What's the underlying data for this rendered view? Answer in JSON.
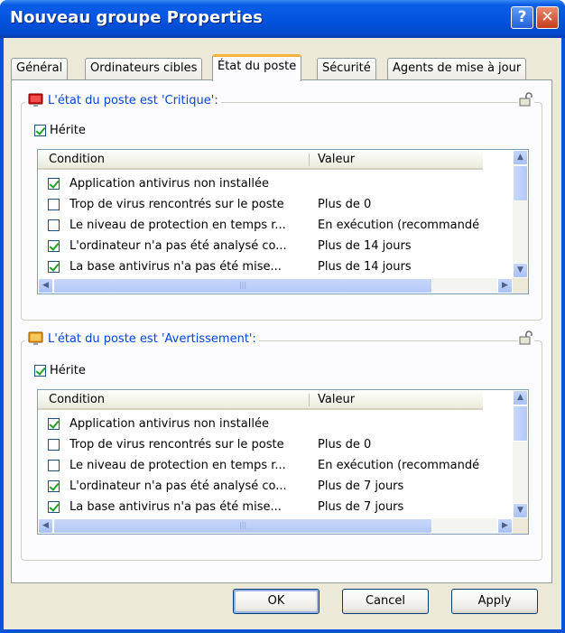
{
  "window": {
    "title": "Nouveau groupe Properties",
    "help_glyph": "?",
    "close_glyph": "✕"
  },
  "tabs": [
    "Général",
    "Ordinateurs cibles",
    "État du poste",
    "Sécurité",
    "Agents de mise à jour"
  ],
  "active_tab": 2,
  "groups": [
    {
      "title": "L'état du poste est 'Critique':",
      "inherit_label": "Hérite",
      "inherit_checked": true,
      "columns": [
        "Condition",
        "Valeur"
      ],
      "rows": [
        {
          "checked": true,
          "condition": "Application antivirus non installée",
          "value": ""
        },
        {
          "checked": false,
          "condition": "Trop de virus rencontrés sur le poste",
          "value": "Plus de 0"
        },
        {
          "checked": false,
          "condition": "Le niveau de protection en temps r...",
          "value": "En exécution (recommandé"
        },
        {
          "checked": true,
          "condition": "L'ordinateur n'a pas été analysé co...",
          "value": "Plus de 14 jours"
        },
        {
          "checked": true,
          "condition": "La base antivirus n'a pas été mise...",
          "value": "Plus de 14 jours"
        }
      ]
    },
    {
      "title": "L'état du poste est 'Avertissement':",
      "inherit_label": "Hérite",
      "inherit_checked": true,
      "columns": [
        "Condition",
        "Valeur"
      ],
      "rows": [
        {
          "checked": true,
          "condition": "Application antivirus non installée",
          "value": ""
        },
        {
          "checked": false,
          "condition": "Trop de virus rencontrés sur le poste",
          "value": "Plus de 0"
        },
        {
          "checked": false,
          "condition": "Le niveau de protection en temps r...",
          "value": "En exécution (recommandé"
        },
        {
          "checked": true,
          "condition": "L'ordinateur n'a pas été analysé co...",
          "value": "Plus de 7 jours"
        },
        {
          "checked": true,
          "condition": "La base antivirus n'a pas été mise...",
          "value": "Plus de 7 jours"
        }
      ]
    }
  ],
  "buttons": {
    "ok": "OK",
    "cancel": "Cancel",
    "apply": "Apply"
  },
  "scroll": {
    "up": "▲",
    "down": "▼",
    "left": "◀",
    "right": "▶",
    "grip": "|||"
  },
  "colors": {
    "titlebar": "#0554e0",
    "group_title": "#0046d5",
    "tab_highlight": "#f6b53a",
    "critical_icon": "#d01818",
    "warning_icon": "#f0a020"
  }
}
